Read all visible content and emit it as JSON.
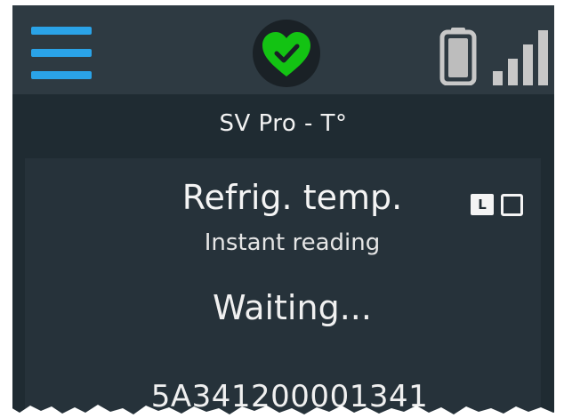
{
  "header": {
    "menu_icon": "hamburger-menu-icon",
    "status_icon": "heart-checkmark-icon",
    "status_color": "#13c313",
    "battery_icon": "battery-icon",
    "signal_icon": "signal-strength-icon",
    "accent_color": "#2aa3e8"
  },
  "device": {
    "title": "SV Pro - T°"
  },
  "reading": {
    "title": "Refrig. temp.",
    "subtitle": "Instant reading",
    "value": "Waiting...",
    "mode_label": "L",
    "serial": "5A341200001341"
  }
}
